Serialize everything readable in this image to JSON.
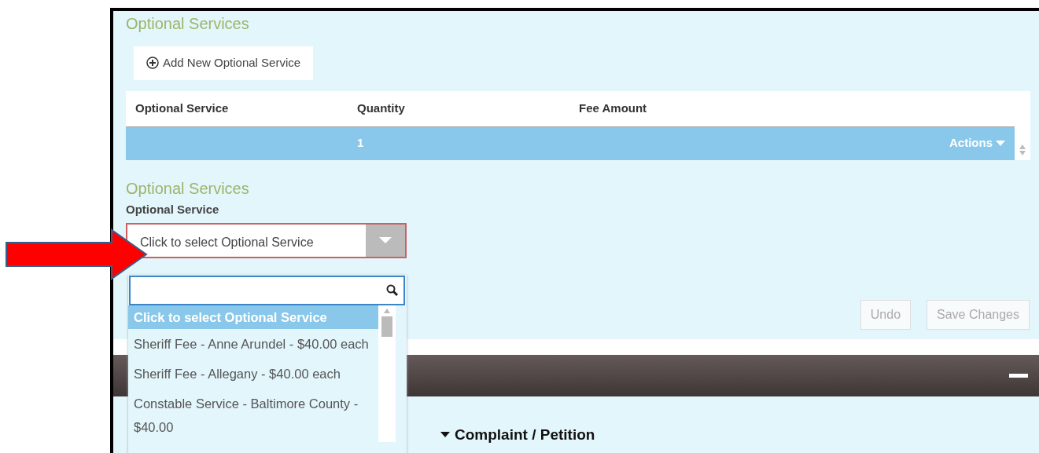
{
  "section_title": "Optional Services",
  "add_button": {
    "label": "Add New Optional Service"
  },
  "table": {
    "columns": [
      "Optional Service",
      "Quantity",
      "Fee Amount"
    ],
    "rows": [
      {
        "optional_service": "",
        "quantity": "1",
        "fee_amount": "",
        "selected": true,
        "actions": "Actions"
      }
    ]
  },
  "form": {
    "title": "Optional Services",
    "field_label": "Optional Service",
    "value": "Click to select Optional Service",
    "invalid": true,
    "dropdown": {
      "open": true,
      "options": [
        {
          "label": "Click to select Optional Service",
          "selected": true
        },
        {
          "label": "Sheriff Fee - Anne Arundel - $40.00 each",
          "selected": false
        },
        {
          "label": "Sheriff Fee - Allegany - $40.00 each",
          "selected": false
        },
        {
          "label": "Constable Service - Baltimore County - $40.00",
          "selected": false
        }
      ]
    }
  },
  "buttons": [
    {
      "label": "Undo",
      "disabled": true
    },
    {
      "label": "Save Changes",
      "disabled": true
    }
  ],
  "next_section": {
    "title": "Complaint / Petition",
    "expanded": true
  }
}
